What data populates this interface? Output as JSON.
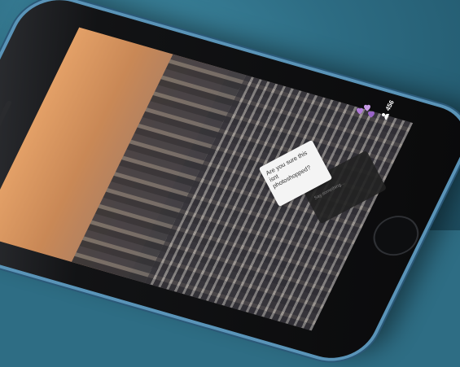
{
  "scene": {
    "subject": "phone-streaming-app"
  },
  "stream": {
    "viewer_count": "456",
    "comment": {
      "username": "",
      "text": "Are you sure this isnt photoshopped?"
    },
    "comment_input_placeholder": "Say something..."
  },
  "colors": {
    "heart_primary": "#b07ad8",
    "heart_secondary": "#c89be6",
    "background": "#2e6d84",
    "phone_rim": "#5a94b8"
  },
  "icons": {
    "viewer": "person-icon",
    "reaction": "heart-icon"
  }
}
